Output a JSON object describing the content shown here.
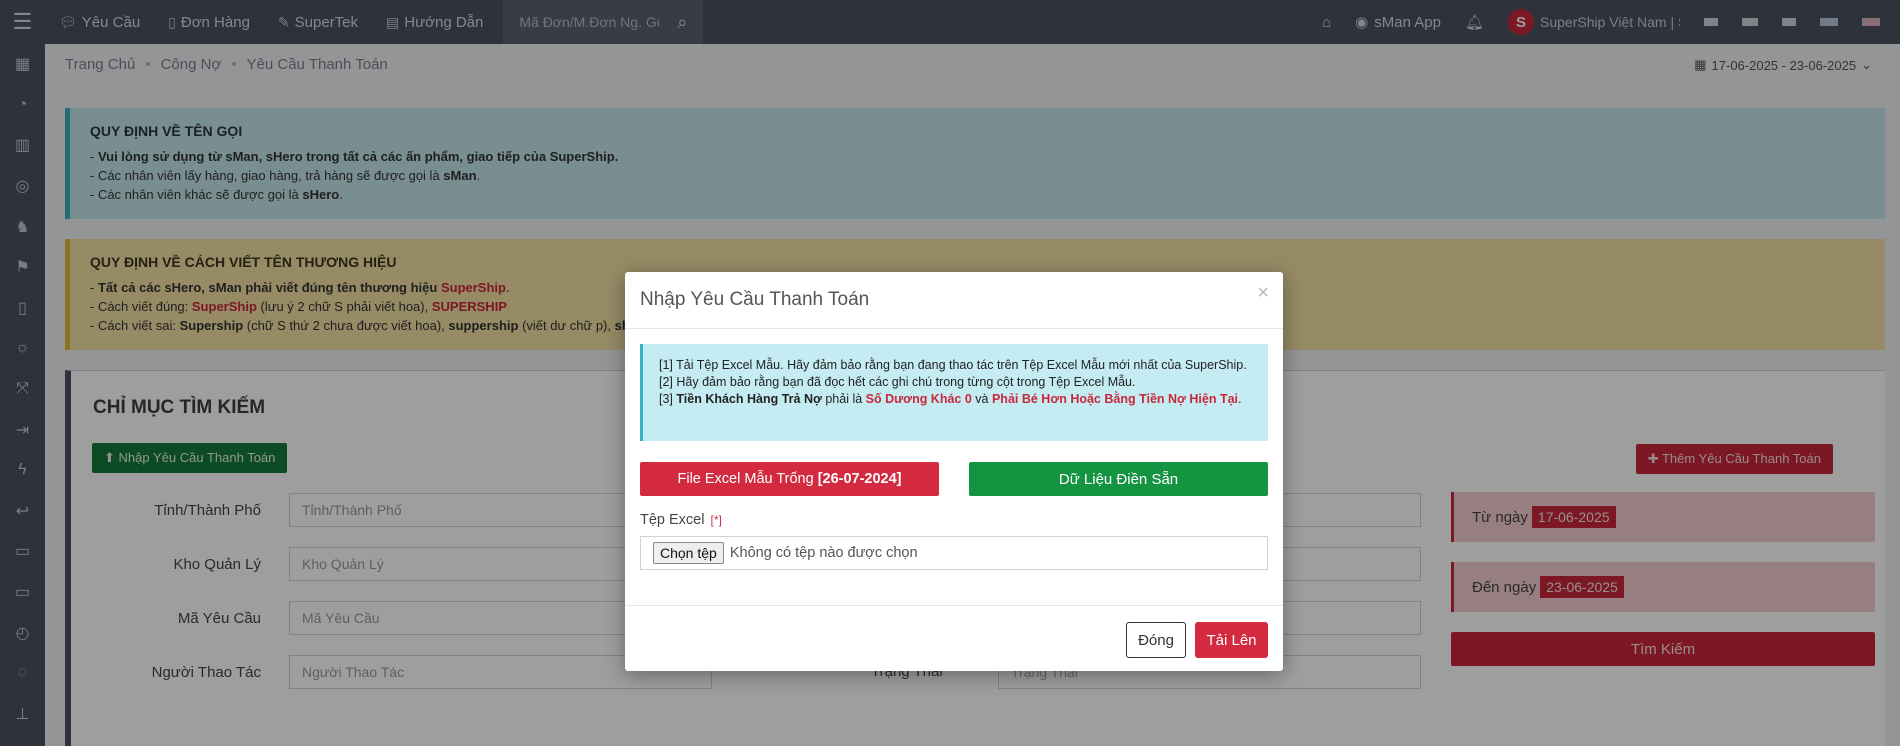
{
  "topbar": {
    "nav": [
      {
        "icon": "chat-bubble-icon",
        "label": "Yêu Cầu"
      },
      {
        "icon": "document-icon",
        "label": "Đơn Hàng"
      },
      {
        "icon": "edit-icon",
        "label": "SuperTek"
      },
      {
        "icon": "book-icon",
        "label": "Hướng Dẫn"
      }
    ],
    "search_placeholder": "Mã Đơn/M.Đơn Ng. Gửi",
    "sman_app_label": "sMan App",
    "company_name": "SuperShip Việt Nam | S"
  },
  "breadcrumb": [
    "Trang Chủ",
    "Công Nợ",
    "Yêu Cầu Thanh Toán"
  ],
  "date_range": "17-06-2025 - 23-06-2025",
  "alert_naming": {
    "title": "QUY ĐỊNH VỀ TÊN GỌI",
    "line1": "Vui lòng sử dụng từ sMan, sHero trong tất cả các ấn phẩm, giao tiếp của SuperShip.",
    "line2_prefix": "- Các nhân viên lấy hàng, giao hàng, trả hàng sẽ được gọi là ",
    "line2_bold": "sMan",
    "line3_prefix": "- Các nhân viên khác sẽ được gọi là ",
    "line3_bold": "sHero"
  },
  "alert_brand": {
    "title": "QUY ĐỊNH VỀ CÁCH VIẾT TÊN THƯƠNG HIỆU",
    "line1": "Tất cả các sHero, sMan phải viết đúng tên thương hiệu ",
    "brand": "SuperShip",
    "line2_prefix": "- Cách viết đúng: ",
    "line2_note": " (lưu ý 2 chữ S phải viết hoa), ",
    "brand_upper": "SUPERSHIP",
    "line3_prefix": "- Cách viết sai: ",
    "wrong1": "Supership",
    "wrong1_note": " (chữ S thứ 2 chưa được viết hoa), ",
    "wrong2": "suppership",
    "wrong2_note": " (viết dư chữ p), ",
    "wrong3": "sh"
  },
  "panel": {
    "title": "CHỈ MỤC TÌM KIẾM",
    "import_button": "Nhập Yêu Cầu Thanh Toán",
    "add_button": "Thêm Yêu Cầu Thanh Toán",
    "fields": [
      {
        "label": "Tỉnh/Thành Phố",
        "placeholder": "Tỉnh/Thành Phố"
      },
      {
        "label": "Kho Quản Lý",
        "placeholder": "Kho Quản Lý"
      },
      {
        "label": "Mã Yêu Cầu",
        "placeholder": "Mã Yêu Cầu"
      },
      {
        "label": "Người Thao Tác",
        "placeholder": "Người Thao Tác"
      }
    ],
    "status_label": "Trạng Thái",
    "status_placeholder": "Trạng Thái",
    "from_label": "Từ ngày",
    "from_value": "17-06-2025",
    "to_label": "Đến ngày",
    "to_value": "23-06-2025",
    "search_button": "Tìm Kiếm"
  },
  "modal": {
    "title": "Nhập Yêu Cầu Thanh Toán",
    "close_symbol": "×",
    "note1": "[1] Tải Tệp Excel Mẫu. Hãy đảm bảo rằng bạn đang thao tác trên Tệp Excel Mẫu mới nhất của SuperShip.",
    "note2": "[2] Hãy đảm bảo rằng bạn đã đọc hết các ghi chú trong từng cột trong Tệp Excel Mẫu.",
    "note3_prefix": "[3] ",
    "note3_bold": "Tiền Khách Hàng Trả Nợ",
    "note3_mid": " phải là ",
    "note3_red1": "Số Dương Khác 0",
    "note3_and": " và ",
    "note3_red2": "Phải Bé Hơn Hoặc Bằng Tiền Nợ Hiện Tại",
    "note3_end": ".",
    "excel_button": "File Excel Mẫu Trống",
    "excel_date": "[26-07-2024]",
    "prefill_button": "Dữ Liệu Điền Sẵn",
    "file_label": "Tệp Excel",
    "required_mark": "[*]",
    "choose_file": "Chọn tệp",
    "no_file": "Không có tệp nào được chọn",
    "close_button": "Đóng",
    "upload_button": "Tải Lên"
  },
  "colors": {
    "primary_red": "#d42a40",
    "green": "#149341",
    "nav_bg": "#4a5160"
  }
}
